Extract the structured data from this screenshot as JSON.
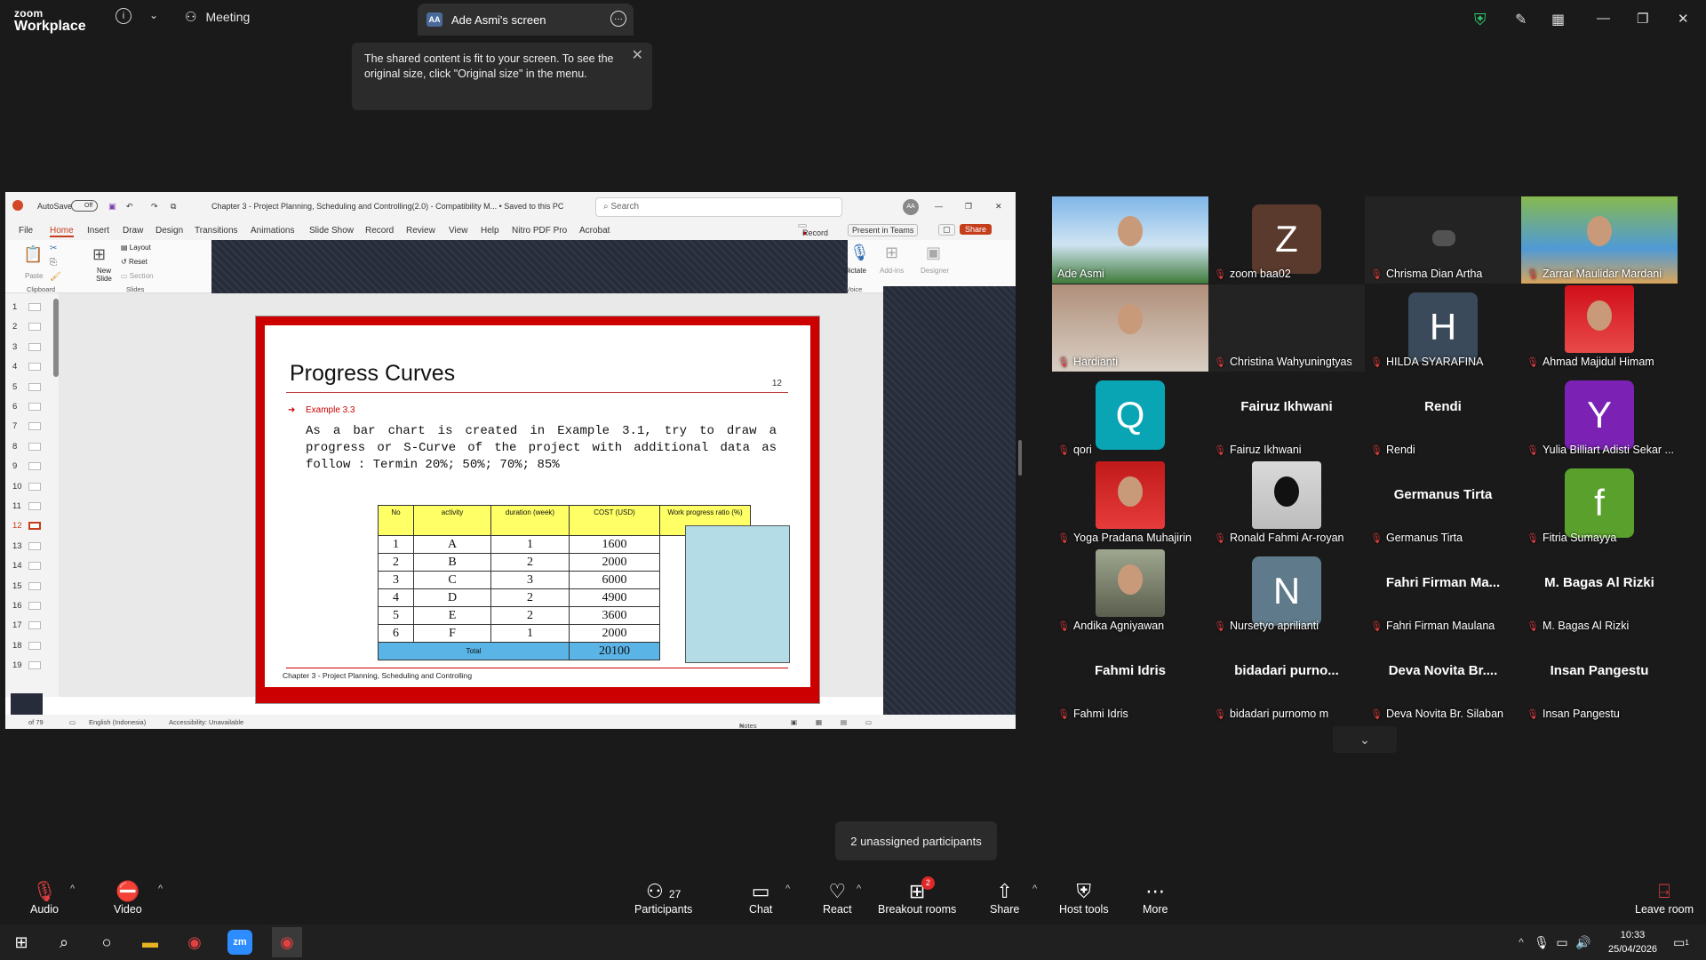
{
  "title_bar": {
    "logo_line1": "zoom",
    "logo_line2": "Workplace",
    "meeting_label": "Meeting",
    "screen_tab_label": "Ade Asmi's screen",
    "screen_tab_badge": "AA"
  },
  "tooltip": {
    "text": "The shared content is fit to your screen. To see the original size, click \"Original size\" in the menu."
  },
  "powerpoint": {
    "autosave": "AutoSave",
    "autosave_state": "Off",
    "doc_title": "Chapter 3 - Project Planning, Scheduling and Controlling(2.0)  -  Compatibility M...  •  Saved to this PC",
    "search_placeholder": "Search",
    "account_initials": "AA",
    "menu": [
      "File",
      "Home",
      "Insert",
      "Draw",
      "Design",
      "Transitions",
      "Animations",
      "Slide Show",
      "Record",
      "Review",
      "View",
      "Help",
      "Nitro PDF Pro",
      "Acrobat"
    ],
    "record_btn": "Record",
    "present_teams_btn": "Present in Teams",
    "share_btn": "Share",
    "ribbon": {
      "paste": "Paste",
      "clipboard": "Clipboard",
      "new_slide": "New Slide",
      "layout": "Layout",
      "reset": "Reset",
      "section": "Section",
      "slides": "Slides",
      "dictate": "Dictate",
      "voice": "Voice",
      "addins": "Add-ins",
      "designer": "Designer"
    },
    "thumb_numbers": [
      "1",
      "2",
      "3",
      "4",
      "5",
      "6",
      "7",
      "8",
      "9",
      "10",
      "11",
      "12",
      "13",
      "14",
      "15",
      "16",
      "17",
      "18",
      "19"
    ],
    "status": {
      "slide_count": "of 79",
      "language": "English (Indonesia)",
      "accessibility": "Accessibility: Unavailable",
      "notes": "Notes"
    }
  },
  "slide": {
    "title": "Progress Curves",
    "page_number": "12",
    "example_label": "Example 3.3",
    "body": "As a bar chart is created in Example 3.1, try to draw a progress or S-Curve of the project with additional data as follow : Termin 20%; 50%; 70%; 85%",
    "table_headers": [
      "No",
      "activity",
      "duration (week)",
      "COST (USD)",
      "Work progress ratio (%)"
    ],
    "table_rows": [
      [
        "1",
        "A",
        "1",
        "1600"
      ],
      [
        "2",
        "B",
        "2",
        "2000"
      ],
      [
        "3",
        "C",
        "3",
        "6000"
      ],
      [
        "4",
        "D",
        "2",
        "4900"
      ],
      [
        "5",
        "E",
        "2",
        "3600"
      ],
      [
        "6",
        "F",
        "1",
        "2000"
      ]
    ],
    "total_label": "Total",
    "total_value": "20100",
    "footer": "Chapter 3 - Project Planning, Scheduling and Controlling"
  },
  "participants": [
    {
      "name": "Ade Asmi",
      "type": "photo",
      "muted": false,
      "active": true
    },
    {
      "name": "zoom baa02",
      "type": "avatar",
      "letter": "Z",
      "color": "#5b3a2e",
      "muted": true
    },
    {
      "name": "Chrisma Dian Artha",
      "type": "blank",
      "muted": true
    },
    {
      "name": "Zarrar Maulidar Mardani",
      "type": "photo",
      "muted": true
    },
    {
      "name": "Hardianti",
      "type": "photo",
      "muted": true
    },
    {
      "name": "Christina Wahyuningtyas",
      "type": "blank",
      "muted": true
    },
    {
      "name": "HILDA SYARAFINA",
      "type": "avatar",
      "letter": "H",
      "color": "#3a4a5a",
      "muted": true
    },
    {
      "name": "Ahmad Majidul Himam",
      "type": "photo",
      "muted": true
    },
    {
      "name": "qori",
      "type": "avatar",
      "letter": "Q",
      "color": "#0aa5b5",
      "muted": true
    },
    {
      "name": "Fairuz Ikhwani",
      "type": "text",
      "big": "Fairuz Ikhwani",
      "muted": true
    },
    {
      "name": "Rendi",
      "type": "text",
      "big": "Rendi",
      "muted": true
    },
    {
      "name": "Yulia Billiart Adisti Sekar ...",
      "type": "avatar",
      "letter": "Y",
      "color": "#7b22b5",
      "muted": true
    },
    {
      "name": "Yoga Pradana Muhajirin",
      "type": "photo",
      "muted": true
    },
    {
      "name": "Ronald Fahmi Ar-royan",
      "type": "photo",
      "muted": true
    },
    {
      "name": "Germanus Tirta",
      "type": "text",
      "big": "Germanus Tirta",
      "muted": true
    },
    {
      "name": "Fitria Sumayya",
      "type": "avatar",
      "letter": "f",
      "color": "#5aa02c",
      "muted": true
    },
    {
      "name": "Andika Agniyawan",
      "type": "photo",
      "muted": true
    },
    {
      "name": "Nursetyo aprilianti",
      "type": "avatar",
      "letter": "N",
      "color": "#5f7a8a",
      "muted": true
    },
    {
      "name": "Fahri Firman Maulana",
      "type": "text",
      "big": "Fahri Firman Ma...",
      "muted": true
    },
    {
      "name": "M. Bagas Al Rizki",
      "type": "text",
      "big": "M. Bagas Al Rizki",
      "muted": true
    },
    {
      "name": "Fahmi Idris",
      "type": "text",
      "big": "Fahmi Idris",
      "muted": true
    },
    {
      "name": "bidadari purnomo m",
      "type": "text",
      "big": "bidadari  purno...",
      "muted": true
    },
    {
      "name": "Deva Novita Br. Silaban",
      "type": "text",
      "big": "Deva Novita Br....",
      "muted": true
    },
    {
      "name": "Insan Pangestu",
      "type": "text",
      "big": "Insan Pangestu",
      "muted": true
    }
  ],
  "unassigned_tooltip": "2 unassigned participants",
  "toolbar": {
    "audio": "Audio",
    "video": "Video",
    "participants": "Participants",
    "participants_count": "27",
    "chat": "Chat",
    "react": "React",
    "breakout": "Breakout rooms",
    "breakout_badge": "2",
    "share": "Share",
    "host_tools": "Host tools",
    "more": "More",
    "leave": "Leave room"
  },
  "taskbar": {
    "time": "10:33",
    "date": "25/04/2026",
    "notif_count": "1"
  },
  "colors": {
    "accent_green": "#3ddc84",
    "muted_red": "#e04040",
    "slide_border": "#cc0000",
    "table_header": "#ffff66",
    "table_total": "#5ab4e6",
    "share_button": "#d13438"
  }
}
